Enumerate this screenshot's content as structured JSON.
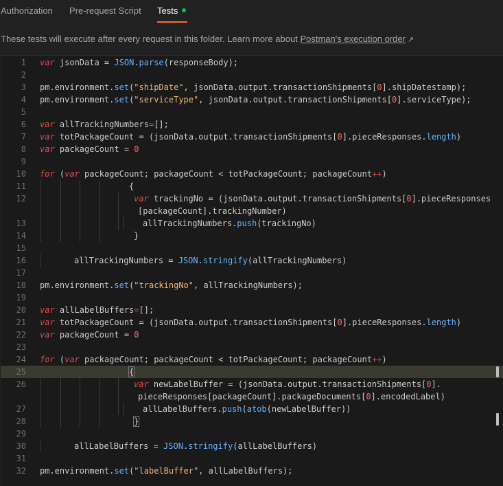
{
  "tabs": [
    {
      "label": "Authorization",
      "active": false
    },
    {
      "label": "Pre-request Script",
      "active": false
    },
    {
      "label": "Tests",
      "active": true,
      "has_indicator": true
    }
  ],
  "info": {
    "text": "These tests will execute after every request in this folder. Learn more about ",
    "link": "Postman's execution order",
    "link_icon": "external-arrow-icon"
  },
  "editor": {
    "highlighted_line": "25",
    "lines": [
      {
        "n": "1",
        "code": "var jsonData = JSON.parse(responseBody);"
      },
      {
        "n": "2",
        "code": ""
      },
      {
        "n": "3",
        "code": "pm.environment.set(\"shipDate\", jsonData.output.transactionShipments[0].shipDatestamp);"
      },
      {
        "n": "4",
        "code": "pm.environment.set(\"serviceType\", jsonData.output.transactionShipments[0].serviceType);"
      },
      {
        "n": "5",
        "code": ""
      },
      {
        "n": "6",
        "code": "var allTrackingNumbers=[];"
      },
      {
        "n": "7",
        "code": "var totPackageCount = (jsonData.output.transactionShipments[0].pieceResponses.length)"
      },
      {
        "n": "8",
        "code": "var packageCount = 0"
      },
      {
        "n": "9",
        "code": ""
      },
      {
        "n": "10",
        "code": "for (var packageCount; packageCount < totPackageCount; packageCount++)"
      },
      {
        "n": "11",
        "code": "{"
      },
      {
        "n": "12",
        "code": "var trackingNo = (jsonData.output.transactionShipments[0].pieceResponses"
      },
      {
        "n": "",
        "code": "[packageCount].trackingNumber)"
      },
      {
        "n": "13",
        "code": "allTrackingNumbers.push(trackingNo)"
      },
      {
        "n": "14",
        "code": "}"
      },
      {
        "n": "15",
        "code": ""
      },
      {
        "n": "16",
        "code": "allTrackingNumbers = JSON.stringify(allTrackingNumbers)"
      },
      {
        "n": "17",
        "code": ""
      },
      {
        "n": "18",
        "code": "pm.environment.set(\"trackingNo\", allTrackingNumbers);"
      },
      {
        "n": "19",
        "code": ""
      },
      {
        "n": "20",
        "code": "var allLabelBuffers=[];"
      },
      {
        "n": "21",
        "code": "var totPackageCount = (jsonData.output.transactionShipments[0].pieceResponses.length)"
      },
      {
        "n": "22",
        "code": "var packageCount = 0"
      },
      {
        "n": "23",
        "code": ""
      },
      {
        "n": "24",
        "code": "for (var packageCount; packageCount < totPackageCount; packageCount++)"
      },
      {
        "n": "25",
        "code": "{"
      },
      {
        "n": "26",
        "code": "var newLabelBuffer = (jsonData.output.transactionShipments[0]."
      },
      {
        "n": "",
        "code": "pieceResponses[packageCount].packageDocuments[0].encodedLabel)"
      },
      {
        "n": "27",
        "code": "allLabelBuffers.push(atob(newLabelBuffer))"
      },
      {
        "n": "28",
        "code": "}"
      },
      {
        "n": "29",
        "code": ""
      },
      {
        "n": "30",
        "code": "allLabelBuffers = JSON.stringify(allLabelBuffers)"
      },
      {
        "n": "31",
        "code": ""
      },
      {
        "n": "32",
        "code": "pm.environment.set(\"labelBuffer\", allLabelBuffers);"
      }
    ]
  },
  "colors": {
    "accent": "#ff6c37",
    "indicator": "#0cbb52",
    "keyword": "#e5484d",
    "object": "#66b2ff",
    "string": "#f0b76e"
  }
}
